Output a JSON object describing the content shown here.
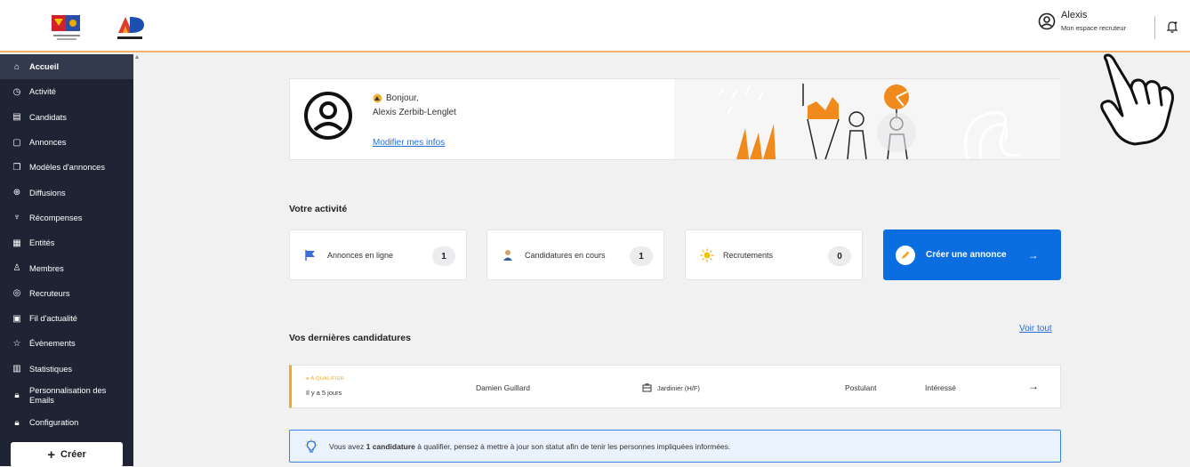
{
  "header": {
    "user_name": "Alexis",
    "user_space": "Mon espace recruteur"
  },
  "sidebar": {
    "items": [
      {
        "label": "Accueil",
        "icon": "home-icon"
      },
      {
        "label": "Activité",
        "icon": "clock-icon"
      },
      {
        "label": "Candidats",
        "icon": "folder-icon"
      },
      {
        "label": "Annonces",
        "icon": "document-icon"
      },
      {
        "label": "Modèles d'annonces",
        "icon": "templates-icon"
      },
      {
        "label": "Diffusions",
        "icon": "broadcast-icon"
      },
      {
        "label": "Récompenses",
        "icon": "trophy-icon"
      },
      {
        "label": "Entités",
        "icon": "building-icon"
      },
      {
        "label": "Membres",
        "icon": "person-icon"
      },
      {
        "label": "Recruteurs",
        "icon": "recruiter-icon"
      },
      {
        "label": "Fil d'actualité",
        "icon": "news-icon"
      },
      {
        "label": "Évènements",
        "icon": "star-icon"
      },
      {
        "label": "Statistiques",
        "icon": "chart-icon"
      },
      {
        "label": "Personnalisation des Emails",
        "icon": "lock-icon"
      },
      {
        "label": "Configuration",
        "icon": "lock-icon"
      }
    ],
    "create_label": "Créer"
  },
  "profile": {
    "greeting": "Bonjour,",
    "name": "Alexis Zerbib-Lenglet",
    "edit_link": "Modifier mes infos"
  },
  "activity": {
    "title": "Votre activité",
    "stats": [
      {
        "label": "Annonces en ligne",
        "count": "1"
      },
      {
        "label": "Candidatures en cours",
        "count": "1"
      },
      {
        "label": "Recrutements",
        "count": "0"
      }
    ],
    "cta_label": "Créer une annonce"
  },
  "candidatures": {
    "title": "Vos dernières candidatures",
    "see_all": "Voir tout",
    "rows": [
      {
        "tag": "À QUALIFIER",
        "ago": "Il y a 5 jours",
        "name": "Damien Guillard",
        "job": "Jardinier (H/F)",
        "status": "Postulant",
        "interest": "Intéressé"
      }
    ]
  },
  "notice": {
    "prefix": "Vous avez",
    "bold": "1 candidature",
    "suffix": "à qualifier, pensez à mettre à jour son statut afin de tenir les personnes impliquées informées."
  },
  "colors": {
    "sidebar_bg": "#1f2434",
    "accent_blue": "#0a6ee1",
    "accent_orange": "#f5a623"
  }
}
